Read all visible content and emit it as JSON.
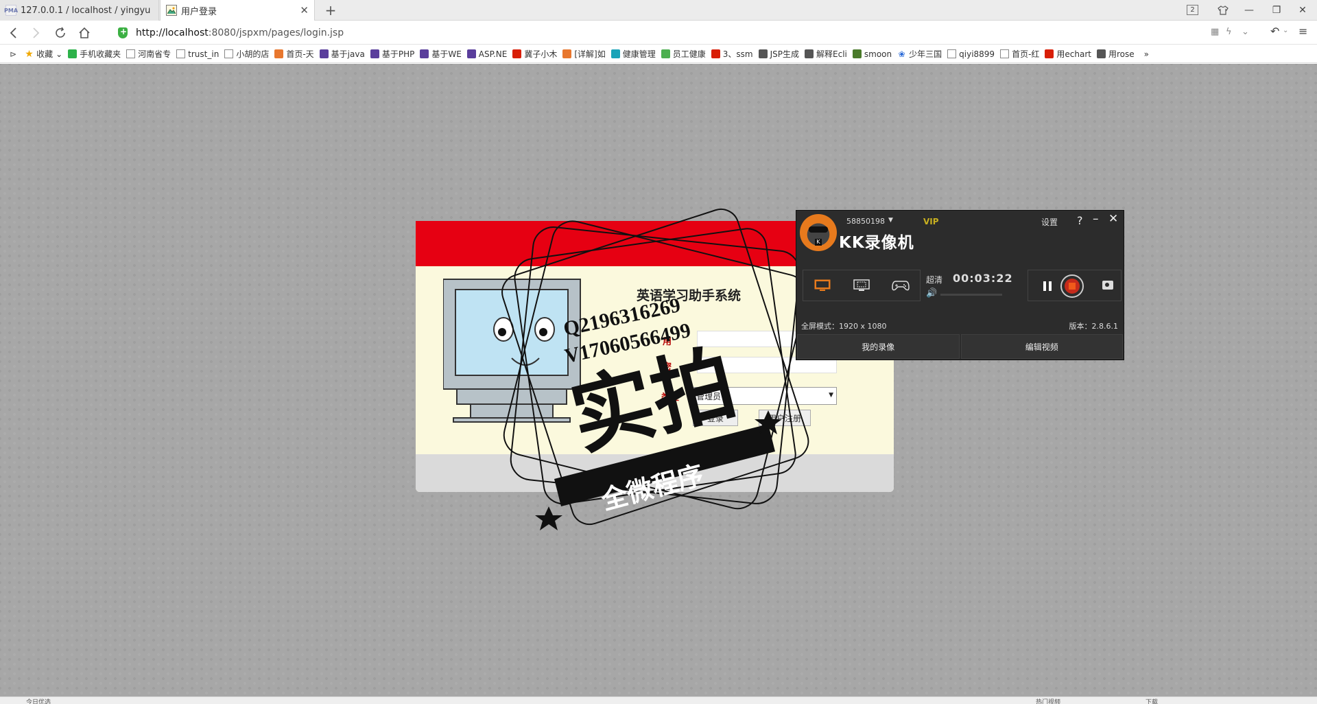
{
  "tabs": [
    {
      "title": "127.0.0.1 / localhost / yingyu",
      "favicon": "phpmyadmin-icon"
    },
    {
      "title": "用户登录",
      "favicon": "picture-icon"
    }
  ],
  "window": {
    "badge": "2"
  },
  "address": {
    "host": "http://localhost",
    "rest": ":8080/jspxm/pages/login.jsp"
  },
  "bookmarks": [
    {
      "label": "收藏",
      "icon": "star-icon",
      "color": "#f0a800"
    },
    {
      "label": "手机收藏夹",
      "icon": "phone-icon",
      "color": "#2db24a"
    },
    {
      "label": "河南省专",
      "icon": "doc-icon",
      "color": ""
    },
    {
      "label": "trust_in",
      "icon": "doc-icon",
      "color": ""
    },
    {
      "label": "小胡的店",
      "icon": "doc-icon",
      "color": ""
    },
    {
      "label": "首页-天",
      "icon": "site-icon",
      "color": "#e8772e"
    },
    {
      "label": "基于java",
      "icon": "site-icon",
      "color": "#5a3e9c"
    },
    {
      "label": "基于PHP",
      "icon": "site-icon",
      "color": "#5a3e9c"
    },
    {
      "label": "基于WE",
      "icon": "site-icon",
      "color": "#5a3e9c"
    },
    {
      "label": "ASP.NE",
      "icon": "site-icon",
      "color": "#5a3e9c"
    },
    {
      "label": "冀子小木",
      "icon": "site-icon",
      "color": "#d81e06"
    },
    {
      "label": "[详解]如",
      "icon": "site-icon",
      "color": "#e8772e"
    },
    {
      "label": "健康管理",
      "icon": "site-icon",
      "color": "#1aa3b8"
    },
    {
      "label": "员工健康",
      "icon": "site-icon",
      "color": "#4caf50"
    },
    {
      "label": "3、ssm",
      "icon": "site-icon",
      "color": "#d81e06"
    },
    {
      "label": "JSP生成",
      "icon": "site-icon",
      "color": "#555555"
    },
    {
      "label": "解释Ecli",
      "icon": "site-icon",
      "color": "#555555"
    },
    {
      "label": "smoon",
      "icon": "site-icon",
      "color": "#4a7a2a"
    },
    {
      "label": "少年三国",
      "icon": "paw-icon",
      "color": "#2a6ad8"
    },
    {
      "label": "qiyi8899",
      "icon": "doc-icon",
      "color": ""
    },
    {
      "label": "首页-红",
      "icon": "doc-icon",
      "color": ""
    },
    {
      "label": "用echart",
      "icon": "site-icon",
      "color": "#d81e06"
    },
    {
      "label": "用rose",
      "icon": "site-icon",
      "color": "#555555"
    }
  ],
  "login": {
    "system_title": "英语学习助手系统",
    "type_label": "类型",
    "type_value": "管理员",
    "login_button": "登录",
    "register_button": "用户注册"
  },
  "watermark": {
    "qq": "Q2196316269",
    "vx": "V17060566499",
    "main": "实拍",
    "ribbon": "全微程序"
  },
  "recorder": {
    "account": "58850198",
    "vip": "VIP",
    "brand": "KK录像机",
    "settings": "设置",
    "quality": "超清",
    "timer": "00:03:22",
    "fullscreen": "全屏模式：1920 x 1080",
    "version": "版本：2.8.6.1",
    "my_videos": "我的录像",
    "edit_video": "编辑视频"
  },
  "statusbar": {
    "left": "今日优选",
    "mid1": "热门视频",
    "mid2": "下载"
  }
}
